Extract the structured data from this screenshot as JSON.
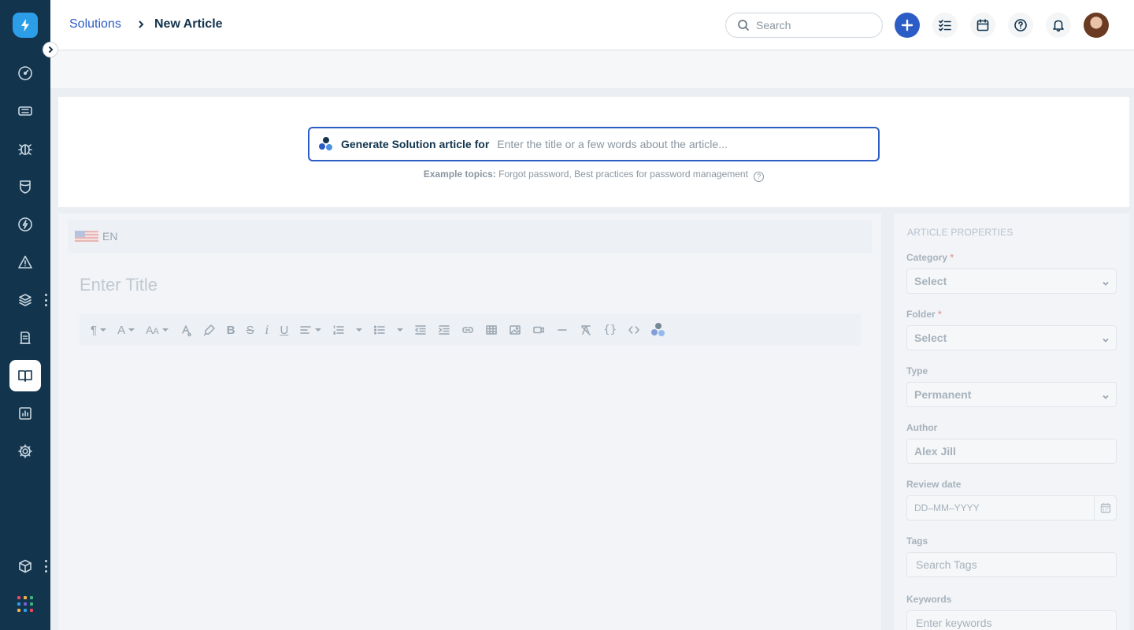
{
  "header": {
    "breadcrumb_link": "Solutions",
    "breadcrumb_current": "New Article",
    "search_placeholder": "Search"
  },
  "sidebar": {
    "items": [
      {
        "icon": "dashboard-icon"
      },
      {
        "icon": "tickets-icon"
      },
      {
        "icon": "problems-icon"
      },
      {
        "icon": "changes-icon"
      },
      {
        "icon": "releases-icon"
      },
      {
        "icon": "alerts-icon"
      },
      {
        "icon": "assets-icon"
      },
      {
        "icon": "contracts-icon"
      },
      {
        "icon": "solutions-icon",
        "active": true
      },
      {
        "icon": "reports-icon"
      },
      {
        "icon": "admin-icon"
      }
    ]
  },
  "generator": {
    "label": "Generate Solution article for",
    "placeholder": "Enter the title or a few words about the article...",
    "examples_label": "Example topics:",
    "examples_text": "Forgot password, Best practices for password management",
    "help_glyph": "?"
  },
  "editor": {
    "language": "EN",
    "title_placeholder": "Enter Title"
  },
  "properties": {
    "heading": "ARTICLE PROPERTIES",
    "category_label": "Category",
    "category_value": "Select",
    "folder_label": "Folder",
    "folder_value": "Select",
    "type_label": "Type",
    "type_value": "Permanent",
    "author_label": "Author",
    "author_value": "Alex Jill",
    "review_date_label": "Review date",
    "review_date_placeholder": "DD–MM–YYYY",
    "tags_label": "Tags",
    "tags_placeholder": "Search Tags",
    "keywords_label": "Keywords",
    "keywords_placeholder": "Enter keywords",
    "required_mark": "*"
  },
  "colors": {
    "sidebar_bg": "#12344d",
    "accent": "#2c5cc5",
    "logo_bg": "#2c9ee8"
  }
}
